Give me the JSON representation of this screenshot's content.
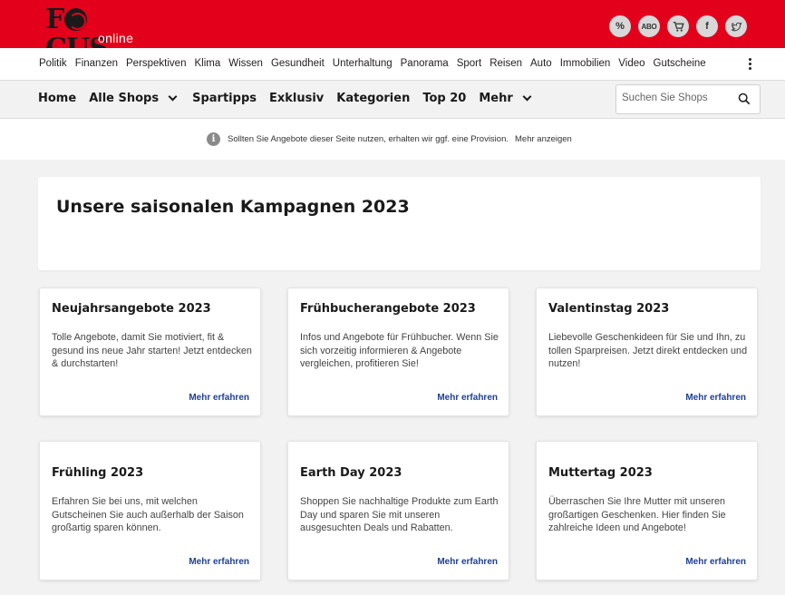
{
  "brand": {
    "logo_main": "FOCUS",
    "logo_sub": "online"
  },
  "header_icons": [
    {
      "icon": "percent-icon",
      "label": "%"
    },
    {
      "icon": "abo-icon",
      "label": "ABO"
    },
    {
      "icon": "cart-icon"
    },
    {
      "icon": "facebook-icon",
      "label": "f"
    },
    {
      "icon": "twitter-icon"
    }
  ],
  "categories": [
    "Politik",
    "Finanzen",
    "Perspektiven",
    "Klima",
    "Wissen",
    "Gesundheit",
    "Unterhaltung",
    "Panorama",
    "Sport",
    "Reisen",
    "Auto",
    "Immobilien",
    "Video",
    "Gutscheine"
  ],
  "shopnav": {
    "home": "Home",
    "alle_shops": "Alle Shops",
    "spartipps": "Spartipps",
    "exklusiv": "Exklusiv",
    "kategorien": "Kategorien",
    "top20": "Top 20",
    "mehr": "Mehr",
    "search_placeholder": "Suchen Sie Shops"
  },
  "infobar": {
    "text": "Sollten Sie Angebote dieser Seite nutzen, erhalten wir ggf. eine Provision.",
    "more": "Mehr anzeigen"
  },
  "page_title": "Unsere saisonalen Kampagnen 2023",
  "campaigns": [
    {
      "title": "Neujahrsangebote 2023",
      "text": "Tolle Angebote, damit Sie motiviert, fit & gesund ins neue Jahr starten! Jetzt entdecken & durchstarten!",
      "link": "Mehr erfahren"
    },
    {
      "title": "Frühbucherangebote 2023",
      "text": "Infos und Angebote für Frühbucher. Wenn Sie sich vorzeitig informieren & Angebote vergleichen, profitieren Sie!",
      "link": "Mehr erfahren"
    },
    {
      "title": "Valentinstag 2023",
      "text": "Liebevolle Geschenkideen für Sie und Ihn, zu tollen Sparpreisen. Jetzt direkt entdecken und nutzen!",
      "link": "Mehr erfahren"
    },
    {
      "title": "Frühling 2023",
      "text": "Erfahren Sie bei uns, mit welchen Gutscheinen Sie auch außerhalb der Saison großartig sparen können.",
      "link": "Mehr erfahren"
    },
    {
      "title": "Earth Day 2023",
      "text": "Shoppen Sie nachhaltige Produkte zum Earth Day und sparen Sie mit unseren ausgesuchten Deals und Rabatten.",
      "link": "Mehr erfahren"
    },
    {
      "title": "Muttertag 2023",
      "text": "Überraschen Sie Ihre Mutter mit unseren großartigen Geschenken. Hier finden Sie zahlreiche Ideen und Angebote!",
      "link": "Mehr erfahren"
    }
  ],
  "colors": {
    "brand_red": "#e3001b",
    "link_blue": "#1f3f8f"
  }
}
